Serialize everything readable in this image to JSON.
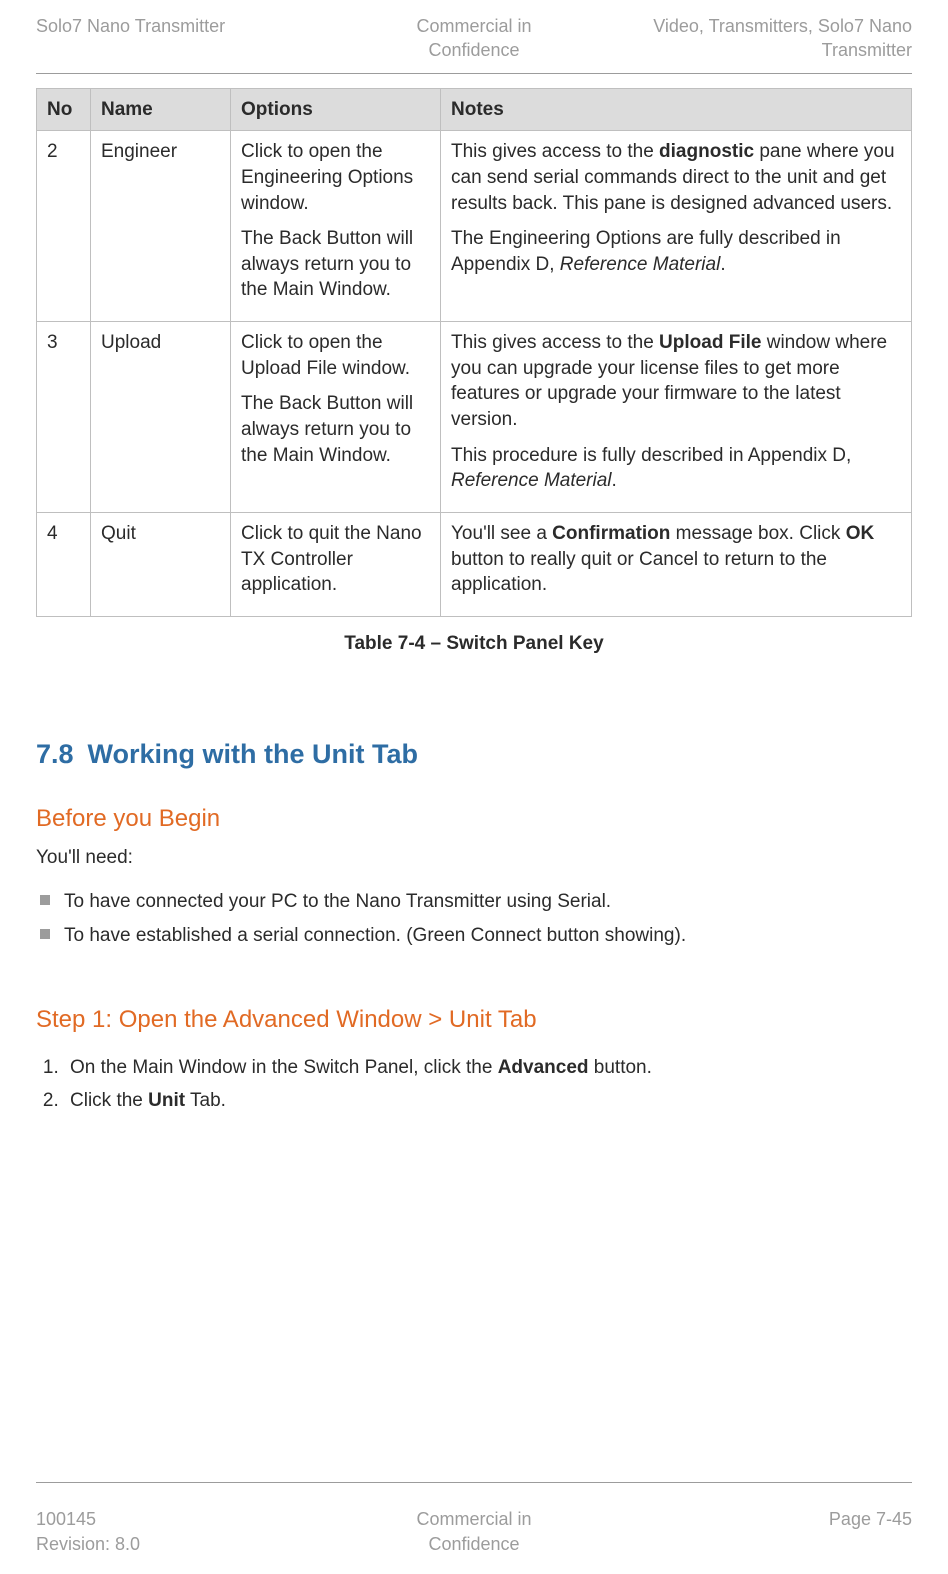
{
  "header": {
    "left": "Solo7 Nano Transmitter",
    "center_line1": "Commercial in",
    "center_line2": "Confidence",
    "right_line1": "Video, Transmitters, Solo7 Nano",
    "right_line2": "Transmitter"
  },
  "table": {
    "headers": {
      "no": "No",
      "name": "Name",
      "options": "Options",
      "notes": "Notes"
    },
    "rows": [
      {
        "no": "2",
        "name": "Engineer",
        "options_p1": "Click to open the Engineering Options window.",
        "options_p2": "The Back Button will always return you to the Main Window.",
        "notes_p1_a": "This gives access to the ",
        "notes_p1_b_bold": "diagnostic",
        "notes_p1_c": " pane where you can send serial commands direct to the unit and get results back. This pane is designed advanced users.",
        "notes_p2_a": "The Engineering Options are fully described in Appendix D, ",
        "notes_p2_b_italic": "Reference Material",
        "notes_p2_c": "."
      },
      {
        "no": "3",
        "name": "Upload",
        "options_p1": "Click to open the Upload File window.",
        "options_p2": "The Back Button will always return you to the Main Window.",
        "notes_p1_a": "This gives access to the ",
        "notes_p1_b_bold": "Upload File",
        "notes_p1_c": " window where you can upgrade your license files to get more features or upgrade your firmware to the latest version.",
        "notes_p2_a": "This procedure is fully described in Appendix D, ",
        "notes_p2_b_italic": "Reference Material",
        "notes_p2_c": "."
      },
      {
        "no": "4",
        "name": "Quit",
        "options_p1": "Click to quit the Nano TX Controller application.",
        "notes_p1_a": "You'll see a ",
        "notes_p1_b_bold": "Confirmation",
        "notes_p1_c": " message box. Click ",
        "notes_p1_d_bold": "OK",
        "notes_p1_e": " button to really quit or Cancel to return to the application."
      }
    ]
  },
  "caption": "Table 7-4 – Switch Panel Key",
  "section": {
    "number": "7.8",
    "title": "Working with the Unit Tab"
  },
  "before": {
    "heading": "Before you Begin",
    "intro": "You'll need:",
    "bullet1": "To have connected your PC to the Nano Transmitter using Serial.",
    "bullet2": "To have established a serial connection. (Green Connect button showing)."
  },
  "step1": {
    "heading": "Step 1: Open the Advanced Window > Unit Tab",
    "item1_a": "On the Main Window in the Switch Panel, click the ",
    "item1_b_bold": "Advanced",
    "item1_c": " button.",
    "item2_a": "Click the ",
    "item2_b_bold": "Unit",
    "item2_c": " Tab."
  },
  "footer": {
    "left_line1": "100145",
    "left_line2": "Revision: 8.0",
    "center_line1": "Commercial in",
    "center_line2": "Confidence",
    "right": "Page 7-45"
  }
}
